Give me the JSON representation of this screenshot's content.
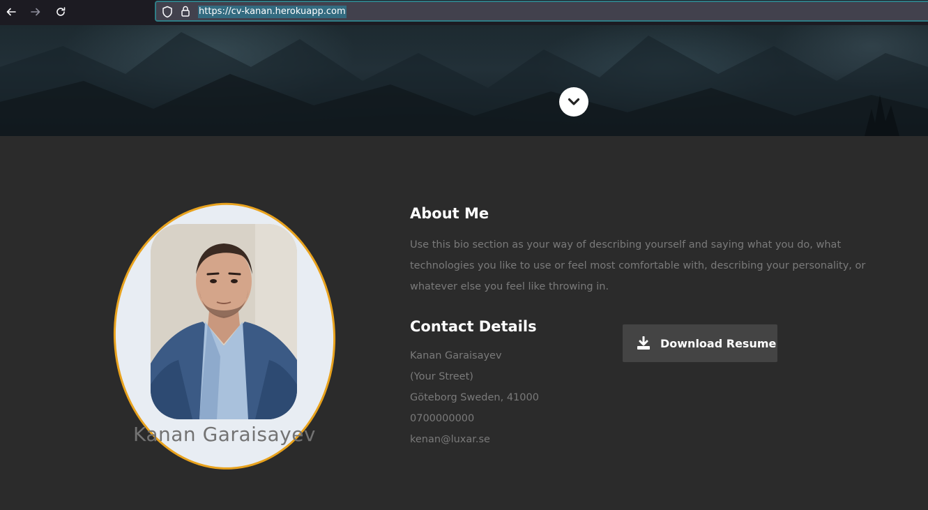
{
  "browser": {
    "url": "https://cv-kanan.herokuapp.com"
  },
  "about": {
    "heading": "About Me",
    "bio": "Use this bio section as your way of describing yourself and saying what you do, what technologies you like to use or feel most comfortable with, describing your personality, or whatever else you feel like throwing in.",
    "profile_name": "Kanan Garaisayev"
  },
  "contact": {
    "heading": "Contact Details",
    "name": "Kanan Garaisayev",
    "street": "(Your Street)",
    "city": "Göteborg Sweden, 41000",
    "phone": "0700000000",
    "email": "kenan@luxar.se"
  },
  "download": {
    "label": "Download Resume"
  },
  "colors": {
    "accent": "#e8a21d",
    "background": "#2b2b2b",
    "button": "#444444"
  }
}
